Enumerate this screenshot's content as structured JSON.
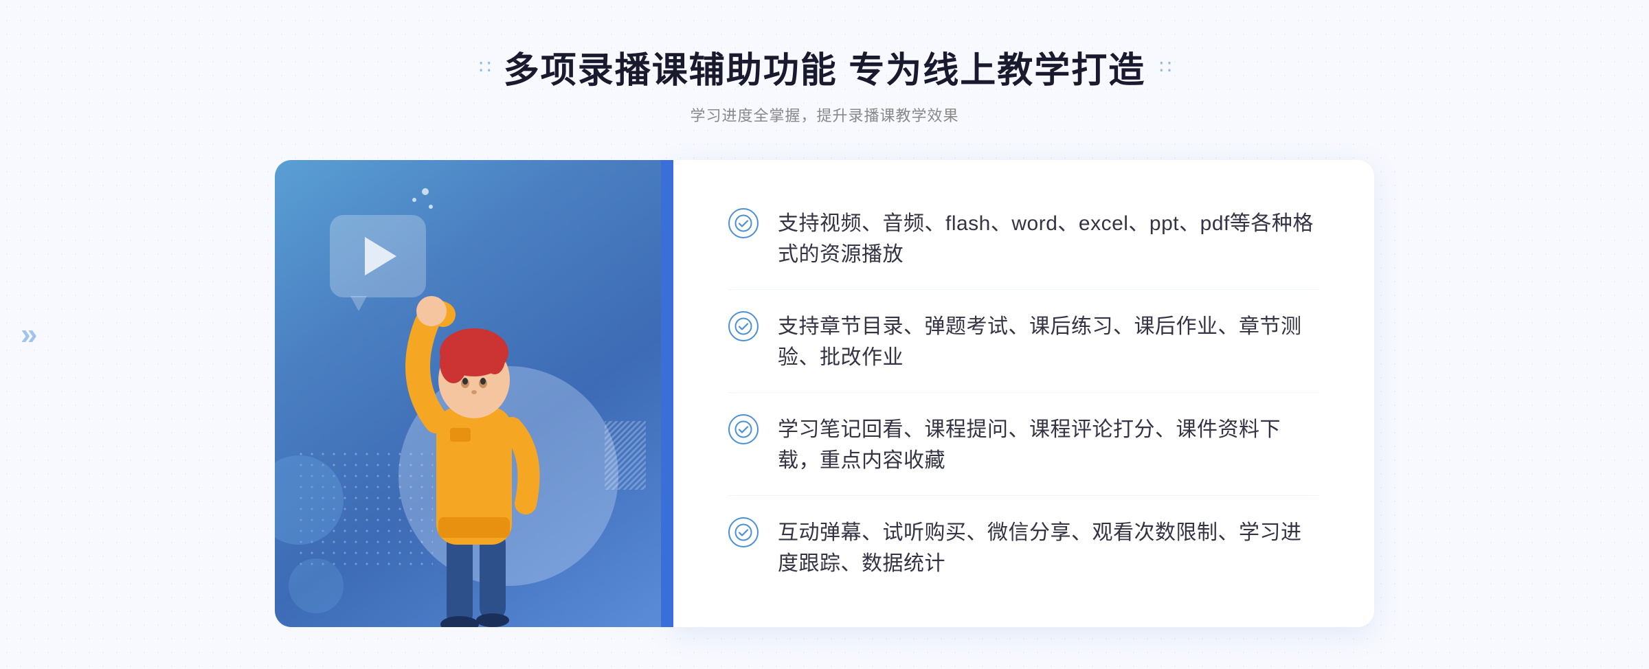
{
  "header": {
    "title": "多项录播课辅助功能 专为线上教学打造",
    "subtitle": "学习进度全掌握，提升录播课教学效果",
    "title_dots_left": "∷",
    "title_dots_right": "∷"
  },
  "features": [
    {
      "id": "feature-1",
      "text": "支持视频、音频、flash、word、excel、ppt、pdf等各种格式的资源播放"
    },
    {
      "id": "feature-2",
      "text": "支持章节目录、弹题考试、课后练习、课后作业、章节测验、批改作业"
    },
    {
      "id": "feature-3",
      "text": "学习笔记回看、课程提问、课程评论打分、课件资料下载，重点内容收藏"
    },
    {
      "id": "feature-4",
      "text": "互动弹幕、试听购买、微信分享、观看次数限制、学习进度跟踪、数据统计"
    }
  ],
  "illustration": {
    "play_icon": "▶",
    "left_arrow": "»"
  },
  "colors": {
    "accent_blue": "#4a90d9",
    "dark_blue": "#3d6bb5",
    "text_dark": "#333344",
    "text_gray": "#888888",
    "bg_light": "#f8f9ff"
  }
}
